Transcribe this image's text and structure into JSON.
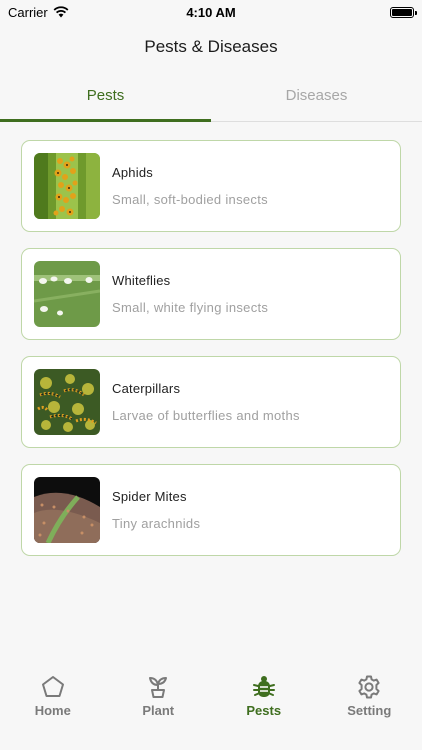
{
  "status": {
    "carrier": "Carrier",
    "time": "4:10 AM"
  },
  "header": {
    "title": "Pests & Diseases"
  },
  "tabs": [
    {
      "label": "Pests",
      "active": true
    },
    {
      "label": "Diseases",
      "active": false
    }
  ],
  "pests": [
    {
      "name": "Aphids",
      "description": "Small, soft-bodied insects",
      "image": "aphids-photo"
    },
    {
      "name": "Whiteflies",
      "description": "Small, white flying insects",
      "image": "whiteflies-photo"
    },
    {
      "name": "Caterpillars",
      "description": "Larvae of butterflies and moths",
      "image": "caterpillars-photo"
    },
    {
      "name": "Spider Mites",
      "description": "Tiny arachnids",
      "image": "spider-mites-photo"
    }
  ],
  "nav": [
    {
      "label": "Home",
      "icon": "home-pentagon-icon",
      "active": false
    },
    {
      "label": "Plant",
      "icon": "sprout-icon",
      "active": false
    },
    {
      "label": "Pests",
      "icon": "bug-icon",
      "active": true
    },
    {
      "label": "Setting",
      "icon": "gear-icon",
      "active": false
    }
  ],
  "colors": {
    "accent": "#3f6e1f",
    "card_border": "#bfd7a8",
    "muted_text": "#a0a0a0"
  }
}
